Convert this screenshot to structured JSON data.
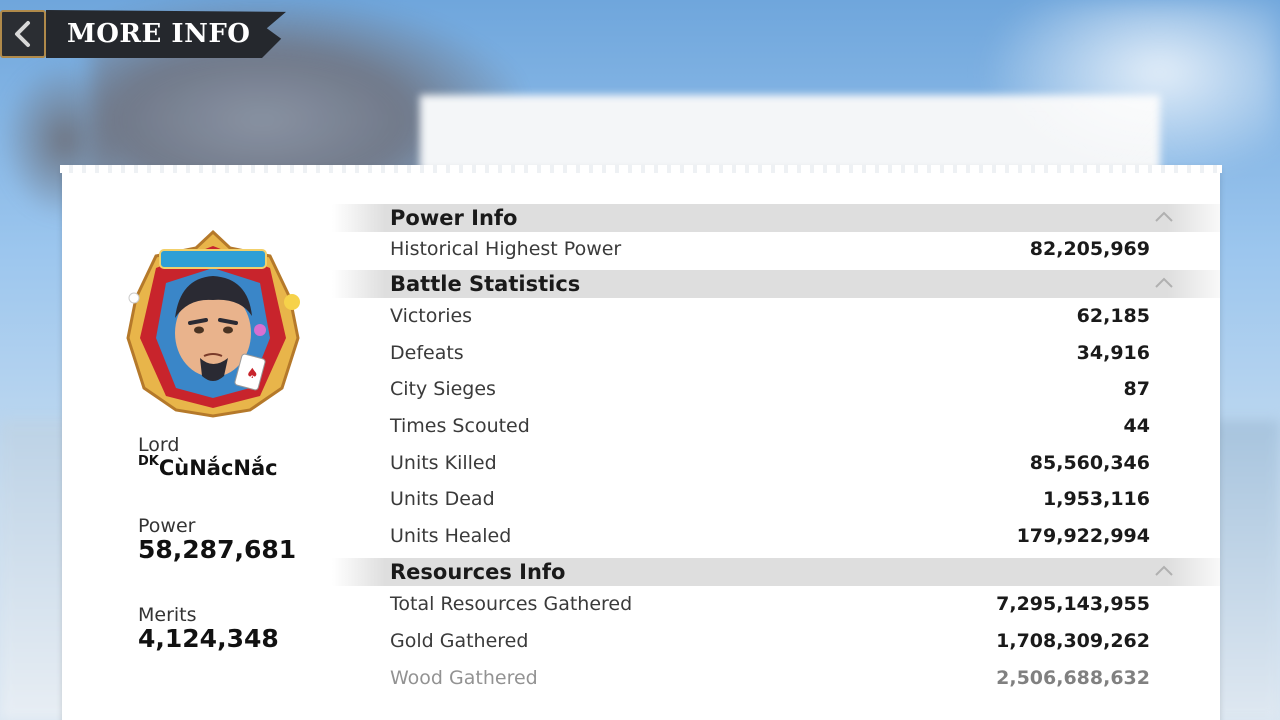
{
  "header": {
    "title": "MORE INFO",
    "back_icon": "chevron-left-icon"
  },
  "profile": {
    "lord_label": "Lord",
    "lord_tag": "DK",
    "lord_name": "CùNắcNắc",
    "power_label": "Power",
    "power_value": "58,287,681",
    "merits_label": "Merits",
    "merits_value": "4,124,348",
    "avatar_icon": "commander-portrait-icon"
  },
  "sections": [
    {
      "title": "Power Info",
      "rows": [
        {
          "label": "Historical Highest Power",
          "value": "82,205,969"
        }
      ]
    },
    {
      "title": "Battle Statistics",
      "rows": [
        {
          "label": "Victories",
          "value": "62,185"
        },
        {
          "label": "Defeats",
          "value": "34,916"
        },
        {
          "label": "City Sieges",
          "value": "87"
        },
        {
          "label": "Times Scouted",
          "value": "44"
        },
        {
          "label": "Units Killed",
          "value": "85,560,346"
        },
        {
          "label": "Units Dead",
          "value": "1,953,116"
        },
        {
          "label": "Units Healed",
          "value": "179,922,994"
        }
      ]
    },
    {
      "title": "Resources Info",
      "rows": [
        {
          "label": "Total Resources Gathered",
          "value": "7,295,143,955"
        },
        {
          "label": "Gold Gathered",
          "value": "1,708,309,262"
        },
        {
          "label": "Wood Gathered",
          "value": "2,506,688,632"
        }
      ]
    }
  ],
  "colors": {
    "panel": "#ffffff",
    "section_header": "#dedede",
    "title_banner": "#25282d",
    "back_border": "#b08a4a"
  }
}
